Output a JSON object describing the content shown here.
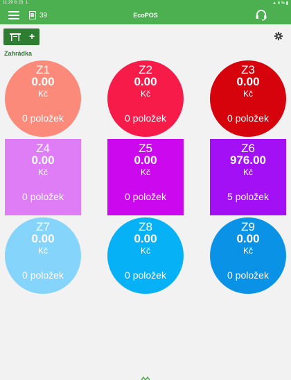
{
  "status_bar": {
    "time": "11:29",
    "date": "čt 23. 1.",
    "battery": "6 %"
  },
  "app_bar": {
    "title": "EcoPOS",
    "document_count": "39",
    "icons": [
      "menu-icon",
      "document-icon",
      "headset-icon"
    ]
  },
  "toolbar": {
    "add_table_label": "+",
    "icons": [
      "table-icon",
      "gear-icon"
    ]
  },
  "section": {
    "name": "Zahrádka"
  },
  "currency": "Kč",
  "tables": [
    {
      "name": "Z1",
      "amount": "0.00",
      "items": "0 položek",
      "color": "#fb8a7a",
      "shape": "round"
    },
    {
      "name": "Z2",
      "amount": "0.00",
      "items": "0 položek",
      "color": "#f71b4a",
      "shape": "round"
    },
    {
      "name": "Z3",
      "amount": "0.00",
      "items": "0 položek",
      "color": "#d6020c",
      "shape": "round"
    },
    {
      "name": "Z4",
      "amount": "0.00",
      "items": "0 položek",
      "color": "#de7df6",
      "shape": "square"
    },
    {
      "name": "Z5",
      "amount": "0.00",
      "items": "0 položek",
      "color": "#cc08ee",
      "shape": "square"
    },
    {
      "name": "Z6",
      "amount": "976.00",
      "items": "5 položek",
      "color": "#a310f5",
      "shape": "square"
    },
    {
      "name": "Z7",
      "amount": "0.00",
      "items": "0 položek",
      "color": "#85d4fb",
      "shape": "round"
    },
    {
      "name": "Z8",
      "amount": "0.00",
      "items": "0 položek",
      "color": "#07b1f6",
      "shape": "round"
    },
    {
      "name": "Z9",
      "amount": "0.00",
      "items": "0 položek",
      "color": "#0a92e6",
      "shape": "round"
    }
  ],
  "colors": {
    "app_bar": "#4caf50",
    "button": "#2e7d32",
    "background": "#f2f2f2"
  }
}
